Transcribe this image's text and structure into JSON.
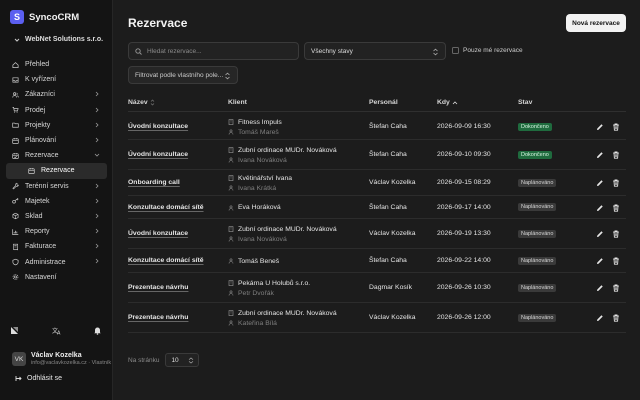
{
  "app": {
    "brand_letter": "S",
    "brand_name": "SyncoCRM",
    "accent": "#5b5ff0"
  },
  "org": {
    "name": "WebNet Solutions s.r.o."
  },
  "sidebar": {
    "items": [
      {
        "label": "Přehled",
        "icon": "home-icon",
        "chevron": false
      },
      {
        "label": "K vyřízení",
        "icon": "inbox-icon",
        "chevron": false
      },
      {
        "label": "Zákazníci",
        "icon": "users-icon",
        "chevron": true
      },
      {
        "label": "Prodej",
        "icon": "cart-icon",
        "chevron": true
      },
      {
        "label": "Projekty",
        "icon": "folder-icon",
        "chevron": true
      },
      {
        "label": "Plánování",
        "icon": "calendar-icon",
        "chevron": true
      },
      {
        "label": "Rezervace",
        "icon": "calendar-check-icon",
        "chevron": true,
        "expanded": true
      },
      {
        "label": "Rezervace",
        "icon": "calendar-icon",
        "sub": true,
        "active": true
      },
      {
        "label": "Terénní servis",
        "icon": "wrench-icon",
        "chevron": true
      },
      {
        "label": "Majetek",
        "icon": "key-icon",
        "chevron": true
      },
      {
        "label": "Sklad",
        "icon": "box-icon",
        "chevron": true
      },
      {
        "label": "Reporty",
        "icon": "chart-icon",
        "chevron": true
      },
      {
        "label": "Fakturace",
        "icon": "invoice-icon",
        "chevron": true
      },
      {
        "label": "Administrace",
        "icon": "admin-icon",
        "chevron": true
      },
      {
        "label": "Nastavení",
        "icon": "gear-icon",
        "chevron": false
      }
    ]
  },
  "user": {
    "initials": "VK",
    "name": "Václav Kozelka",
    "meta": "info@vaclavkozelka.cz · Vlastník",
    "logout": "Odhlásit se"
  },
  "main": {
    "title": "Rezervace",
    "new_button": "Nová rezervace",
    "search_placeholder": "Hledat rezervace...",
    "status_filter": "Všechny stavy",
    "only_mine": "Pouze mé rezervace",
    "custom_filter": "Filtrovat podle vlastního pole...",
    "columns": {
      "name": "Název",
      "client": "Klient",
      "staff": "Personál",
      "date": "Kdy",
      "status": "Stav"
    }
  },
  "rows": [
    {
      "name": "Úvodní konzultace",
      "company": "Fitness Impuls",
      "contact": "Tomáš Mareš",
      "staff": "Štefan Caha",
      "date": "2026-09-09 16:30",
      "status": "Dokončeno",
      "status_type": "done"
    },
    {
      "name": "Úvodní konzultace",
      "company": "Zubní ordinace MUDr. Nováková",
      "contact": "Ivana Nováková",
      "staff": "Štefan Caha",
      "date": "2026-09-10 09:30",
      "status": "Dokončeno",
      "status_type": "done"
    },
    {
      "name": "Onboarding call",
      "company": "Květinářství Ivana",
      "contact": "Ivana Krátká",
      "staff": "Václav Kozelka",
      "date": "2026-09-15 08:29",
      "status": "Naplánováno",
      "status_type": "planned"
    },
    {
      "name": "Konzultace domácí sítě",
      "company": "",
      "contact": "Eva Horáková",
      "staff": "Štefan Caha",
      "date": "2026-09-17 14:00",
      "status": "Naplánováno",
      "status_type": "planned"
    },
    {
      "name": "Úvodní konzultace",
      "company": "Zubní ordinace MUDr. Nováková",
      "contact": "Ivana Nováková",
      "staff": "Václav Kozelka",
      "date": "2026-09-19 13:30",
      "status": "Naplánováno",
      "status_type": "planned"
    },
    {
      "name": "Konzultace domácí sítě",
      "company": "",
      "contact": "Tomáš Beneš",
      "staff": "Štefan Caha",
      "date": "2026-09-22 14:00",
      "status": "Naplánováno",
      "status_type": "planned"
    },
    {
      "name": "Prezentace návrhu",
      "company": "Pekárna U Holubů s.r.o.",
      "contact": "Petr Dvořák",
      "staff": "Dagmar Kosík",
      "date": "2026-09-26 10:30",
      "status": "Naplánováno",
      "status_type": "planned"
    },
    {
      "name": "Prezentace návrhu",
      "company": "Zubní ordinace MUDr. Nováková",
      "contact": "Kateřina Bílá",
      "staff": "Václav Kozelka",
      "date": "2026-09-26 12:00",
      "status": "Naplánováno",
      "status_type": "planned"
    }
  ],
  "pager": {
    "label": "Na stránku",
    "value": "10"
  }
}
